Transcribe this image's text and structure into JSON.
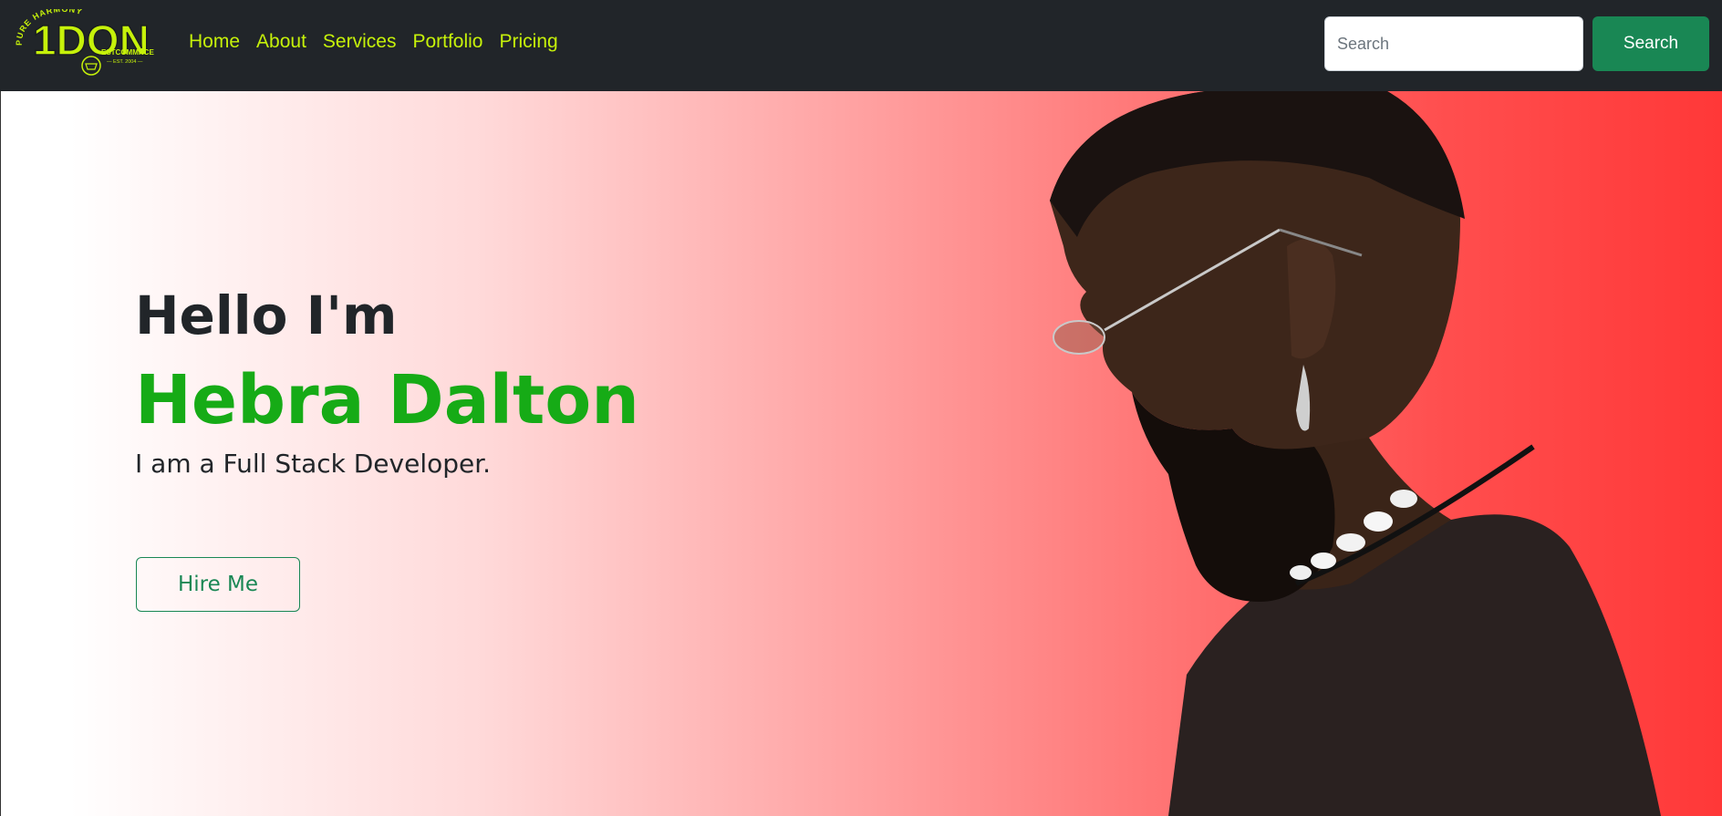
{
  "header": {
    "logo": {
      "arc_text": "PURE HARMONY",
      "brand": "1DON",
      "tagline": "ESTCOMMNCE",
      "est": "— EST. 2004 —",
      "color": "#c6f10a"
    },
    "nav": [
      {
        "label": "Home"
      },
      {
        "label": "About"
      },
      {
        "label": "Services"
      },
      {
        "label": "Portfolio"
      },
      {
        "label": "Pricing"
      }
    ],
    "search": {
      "placeholder": "Search",
      "value": "",
      "button_label": "Search"
    }
  },
  "hero": {
    "greeting": "Hello I'm",
    "name": "Hebra Dalton",
    "role": "I am a Full Stack Developer.",
    "cta_label": "Hire Me",
    "image": "portrait-of-man-with-glasses-and-shell-necklace"
  },
  "colors": {
    "navbar_bg": "#212529",
    "nav_link": "#c6f10a",
    "name_green": "#16ab16",
    "button_green": "#198754",
    "hero_gradient_end": "#ff3838"
  }
}
